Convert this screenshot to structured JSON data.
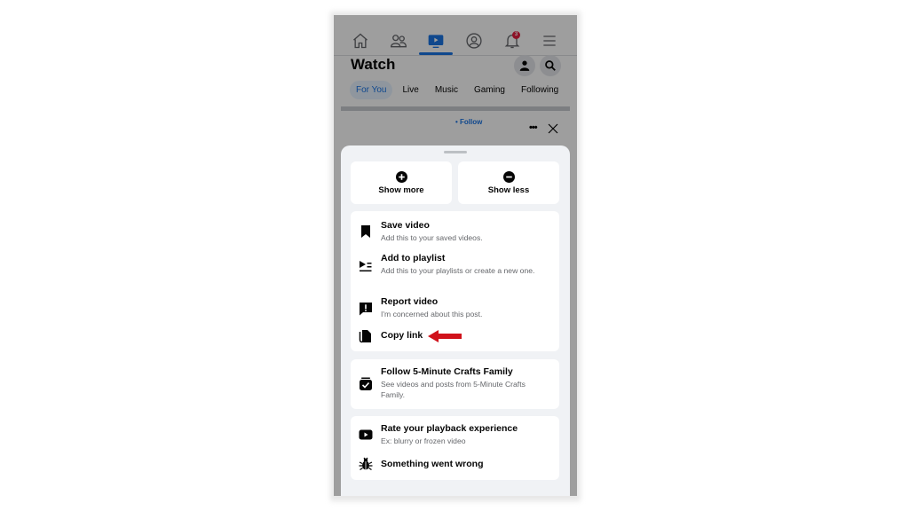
{
  "app": {
    "nav": {
      "items": [
        {
          "name": "home",
          "icon": "home-icon"
        },
        {
          "name": "friends",
          "icon": "friends-icon"
        },
        {
          "name": "watch",
          "icon": "watch-icon",
          "active": true
        },
        {
          "name": "profile",
          "icon": "profile-icon"
        },
        {
          "name": "notifications",
          "icon": "bell-icon",
          "badge": "3"
        },
        {
          "name": "menu",
          "icon": "hamburger-menu-icon"
        }
      ],
      "notification_badge": "3"
    },
    "header": {
      "title": "Watch",
      "profile_button_icon": "person-icon",
      "search_button_icon": "search-icon"
    },
    "tabs": [
      {
        "label": "For You",
        "active": true
      },
      {
        "label": "Live"
      },
      {
        "label": "Music"
      },
      {
        "label": "Gaming"
      },
      {
        "label": "Following"
      }
    ],
    "post": {
      "follow_label": "• Follow",
      "more_icon": "more-dots-icon",
      "close_icon": "close-icon"
    }
  },
  "sheet": {
    "quick_actions": [
      {
        "label": "Show more",
        "icon": "plus-circle-icon"
      },
      {
        "label": "Show less",
        "icon": "minus-circle-icon"
      }
    ],
    "group1": [
      {
        "title": "Save video",
        "subtitle": "Add this to your saved videos.",
        "icon": "bookmark-icon"
      },
      {
        "title": "Add to playlist",
        "subtitle": "Add this to your playlists or create a new one.",
        "icon": "playlist-add-icon"
      },
      {
        "title": "Report video",
        "subtitle": "I'm concerned about this post.",
        "icon": "report-icon"
      },
      {
        "title": "Copy link",
        "subtitle": "",
        "icon": "copy-link-icon",
        "annotation": "red-arrow"
      }
    ],
    "group2": [
      {
        "title": "Follow 5-Minute Crafts Family",
        "subtitle": "See videos and posts from 5-Minute Crafts Family.",
        "icon": "follow-page-icon"
      }
    ],
    "group3": [
      {
        "title": "Rate your playback experience",
        "subtitle": "Ex: blurry or frozen video",
        "icon": "play-video-icon"
      },
      {
        "title": "Something went wrong",
        "subtitle": "",
        "icon": "bug-icon"
      }
    ]
  },
  "colors": {
    "accent": "#1b74e4",
    "badge": "#e41e3f",
    "annotation_arrow": "#d0121b",
    "sheet_bg": "#f0f2f5",
    "text_primary": "#050505",
    "text_secondary": "#65676b"
  }
}
